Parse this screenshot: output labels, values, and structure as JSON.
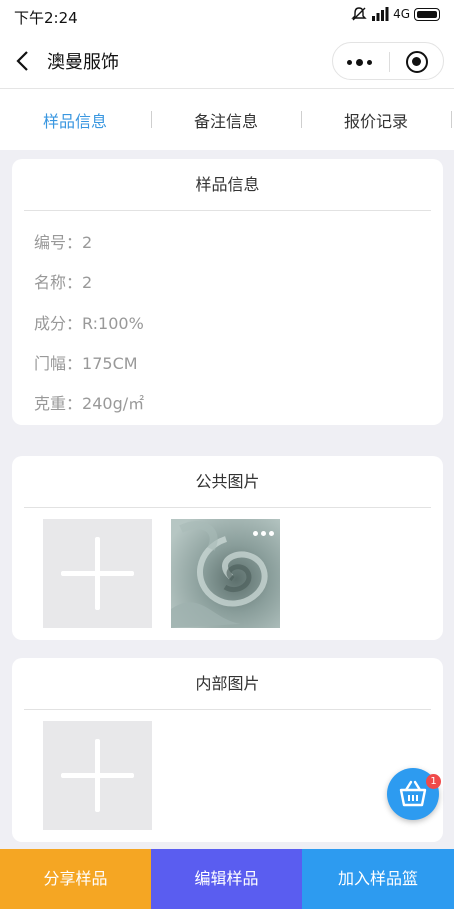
{
  "status": {
    "time": "下午2:24",
    "network": "4G",
    "icons": [
      "mute-icon",
      "signal-icon",
      "battery-icon"
    ]
  },
  "nav": {
    "title": "澳曼服饰",
    "back_icon": "chevron-left-icon"
  },
  "tabs": [
    {
      "label": "样品信息",
      "active": true
    },
    {
      "label": "备注信息",
      "active": false
    },
    {
      "label": "报价记录",
      "active": false
    }
  ],
  "sample_info": {
    "title": "样品信息",
    "rows": [
      {
        "label": "编号",
        "value": "2"
      },
      {
        "label": "名称",
        "value": "2"
      },
      {
        "label": "成分",
        "value": "R:100%"
      },
      {
        "label": "门幅",
        "value": "175CM"
      },
      {
        "label": "克重",
        "value": "240g/㎡"
      }
    ]
  },
  "public_images": {
    "title": "公共图片"
  },
  "internal_images": {
    "title": "内部图片"
  },
  "cart_badge": "1",
  "bottom": {
    "share": "分享样品",
    "edit": "编辑样品",
    "add": "加入样品篮"
  },
  "colors": {
    "accent": "#3a97e0",
    "share_bg": "#f5a623",
    "edit_bg": "#5a5df0",
    "add_bg": "#2d9bf0"
  }
}
